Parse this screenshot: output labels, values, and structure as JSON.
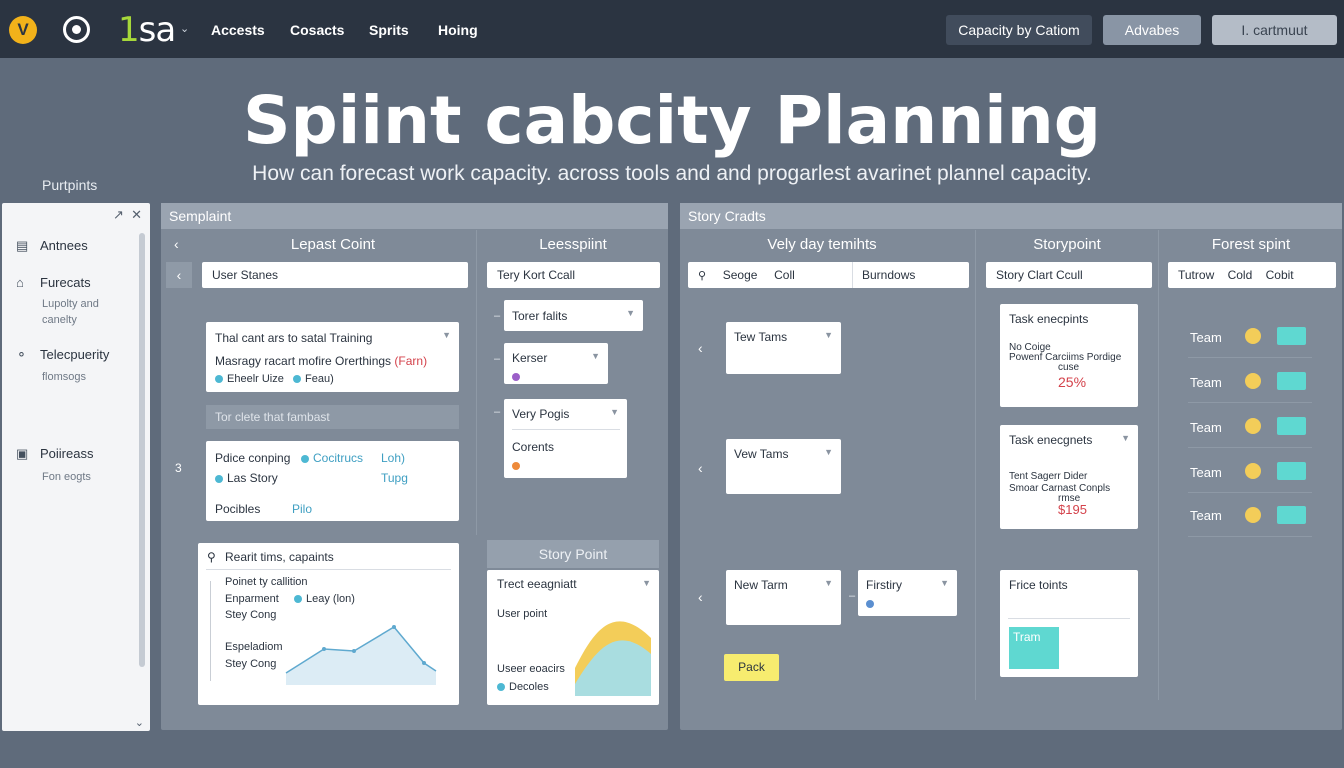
{
  "topbar": {
    "logo_letter": "V",
    "brand_prefix": "1",
    "brand_rest": "sa",
    "nav": [
      "Accests",
      "Cosacts",
      "Sprits",
      "Hoing"
    ],
    "buttons": [
      "Capacity by Catiom",
      "Advabes",
      "I. cartmuut"
    ]
  },
  "hero": {
    "title": "Spiint cabcity Planning",
    "subtitle": "How can forecast work capacity. across tools and and progarlest avarinet plannel capacity."
  },
  "sidebar": {
    "heading": "Purtpints",
    "items": [
      {
        "label": "Antnees",
        "icon": "layout-icon"
      },
      {
        "label": "Furecats",
        "icon": "home-icon",
        "sub": [
          "Lupolty and",
          "canelty"
        ]
      },
      {
        "label": "Telecpuerity",
        "icon": "shield-icon",
        "sub": [
          "flomsogs"
        ]
      },
      {
        "label": "Poiireass",
        "icon": "monitor-icon",
        "sub": [
          "Fon eogts"
        ]
      }
    ]
  },
  "panel_left": {
    "title": "Semplaint",
    "col1_head": "Lepast Coint",
    "col2_head": "Leesspiint",
    "field_user": "User Stanes",
    "field_tery": "Tery Kort    Ccall",
    "card_training": {
      "line1": "Thal cant ars to satal Training",
      "line2": "Masragy racart mofire Orerthings",
      "line2_tag": "(Farn)",
      "tag1": "Eheelr Uize",
      "tag2": "Feau)"
    },
    "placeholder": "Tor clete that fambast",
    "card_police": {
      "l1a": "Pdice conping",
      "l1b": "Cocitrucs",
      "l1c": "Loh)",
      "l2a": "Las Story",
      "l2b": "Tupg",
      "l3a": "Pocibles",
      "l3b": "Pilo"
    },
    "card_search": {
      "title": "Rearit tims, capaints",
      "l1": "Poinet ty callition",
      "l2": "Enparment",
      "l2b": "Leay (lon)",
      "l3": "Stey Cong",
      "l4": "Espeladiom",
      "l5": "Stey Cong"
    },
    "row_num": "3",
    "mini_cards": [
      "Torer falits",
      "Kerser",
      "Very Pogis",
      "Corents"
    ],
    "story_point_label": "Story Point",
    "chart_card": {
      "title": "Trect eeagniatt",
      "l1": "User point",
      "l2": "Useer eoacirs",
      "l3": "Decoles"
    }
  },
  "panel_right": {
    "title": "Story Cradts",
    "col1_head": "Vely day temihts",
    "col2_head": "Storypoint",
    "col3_head": "Forest spint",
    "field1a": "Seoge",
    "field1b": "Coll",
    "field1c": "Burndows",
    "field2": "Story Clart    Ccull",
    "field3a": "Tutrow",
    "field3b": "Cold",
    "field3c": "Cobit",
    "cards": [
      "Tew Tams",
      "Vew Tams",
      "New Tarm",
      "Firstiry"
    ],
    "pack_label": "Pack",
    "task1": {
      "title": "Task enecpints",
      "l1": "No Coige",
      "l2": "Powenf Carciims Pordige",
      "l3": "cuse",
      "pct": "25%"
    },
    "task2": {
      "title": "Task enecgnets",
      "l1": "Tent Sagerr Dider",
      "l2": "Smoar Carnast Conpls",
      "l3": "rmse",
      "val": "$195"
    },
    "price": {
      "title": "Frice toints",
      "tram": "Tram"
    },
    "team_label": "Team",
    "team_rows": 5
  },
  "colors": {
    "topbar": "#2b3441",
    "accent_teal": "#5fd8d1",
    "accent_yellow": "#f3cd59",
    "pack_yellow": "#f7ec6f"
  }
}
